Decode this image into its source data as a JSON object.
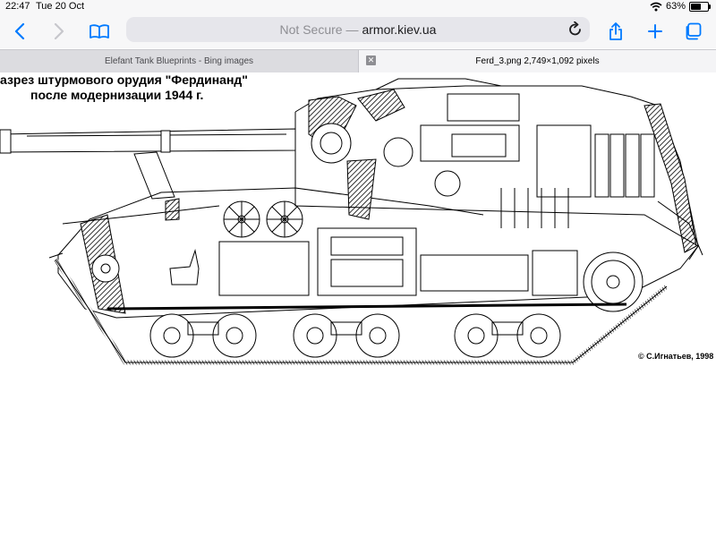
{
  "status_bar": {
    "time": "22:47",
    "date": "Tue 20 Oct",
    "battery_text": "63%",
    "battery_level": 0.63
  },
  "toolbar": {
    "address_security": "Not Secure —",
    "address_host": "armor.kiev.ua",
    "icons": [
      "chevron-left-icon",
      "chevron-right-icon",
      "book-icon",
      "reload-icon",
      "share-icon",
      "plus-icon",
      "tabs-icon"
    ]
  },
  "tabs": [
    {
      "label": "Elefant Tank Blueprints - Bing images",
      "active": false
    },
    {
      "label": "Ferd_3.png 2,749×1,092 pixels",
      "active": true,
      "close_label": "✕"
    }
  ],
  "image": {
    "title_line1": "азрез штурмового орудия \"Фердинанд\"",
    "title_line2": "после модернизации 1944 г.",
    "copyright": "© С.Игнатьев, 1998"
  },
  "colors": {
    "accent": "#007aff",
    "chrome": "#f7f7f8",
    "address_bg": "#e6e6eb",
    "tab_bar": "#dcdce0"
  }
}
